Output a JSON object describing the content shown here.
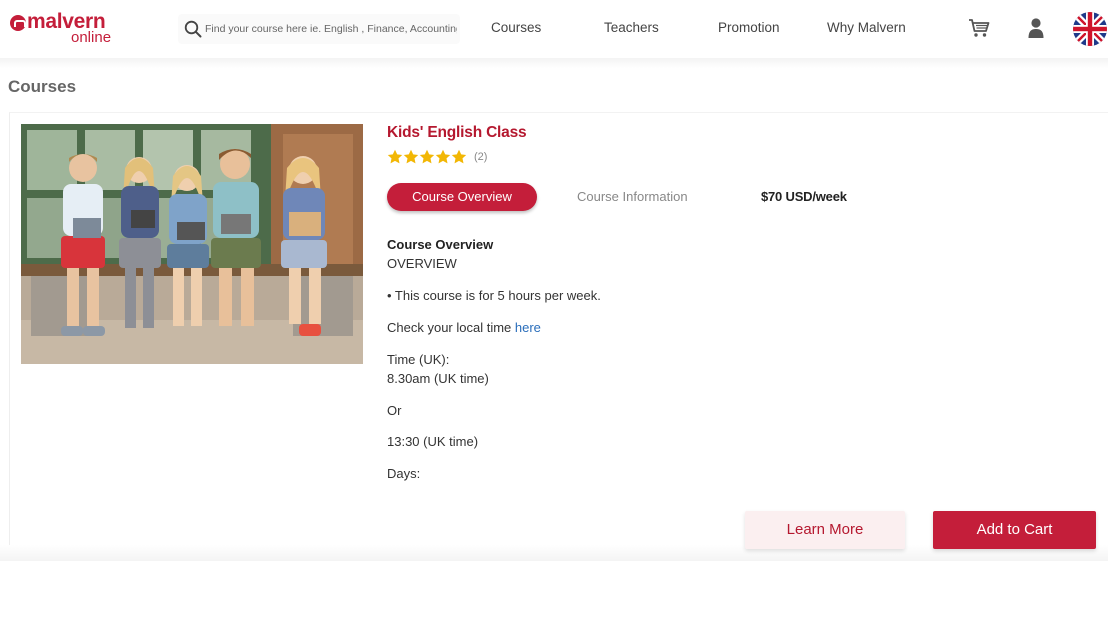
{
  "header": {
    "logo": {
      "word1": "malvern",
      "word2": "online",
      "icon": "malvern-logo-mark"
    },
    "search": {
      "placeholder": "Find your course here ie. English , Finance, Accounting",
      "value": "",
      "icon": "search-icon"
    },
    "nav": [
      {
        "label": "Courses"
      },
      {
        "label": "Teachers"
      },
      {
        "label": "Promotion"
      },
      {
        "label": "Why Malvern"
      }
    ],
    "icons": {
      "cart": "cart-icon",
      "user": "user-icon",
      "language": "uk-flag-icon"
    }
  },
  "page": {
    "title": "Courses"
  },
  "course": {
    "title": "Kids' English Class",
    "rating": {
      "stars": 5,
      "max": 5,
      "count_label": "(2)"
    },
    "image": "kids-reading-tablets-photo",
    "tabs": {
      "overview": "Course Overview",
      "information": "Course Information"
    },
    "price": "$70 USD/week",
    "description": {
      "heading": "Course Overview",
      "line1": "OVERVIEW",
      "line2": "• This course is for 5 hours per week.",
      "line3_prefix": "Check your local time ",
      "line3_link": "here",
      "line4": "Time (UK):",
      "line5": "8.30am (UK time)",
      "line6": "Or",
      "line7": "13:30 (UK time)",
      "line8": "Days:"
    },
    "buttons": {
      "learn_more": "Learn More",
      "add_to_cart": "Add to Cart"
    }
  },
  "colors": {
    "brand_red": "#c41e3a",
    "link_blue": "#2a6ebb",
    "star_gold": "#f2b705"
  }
}
